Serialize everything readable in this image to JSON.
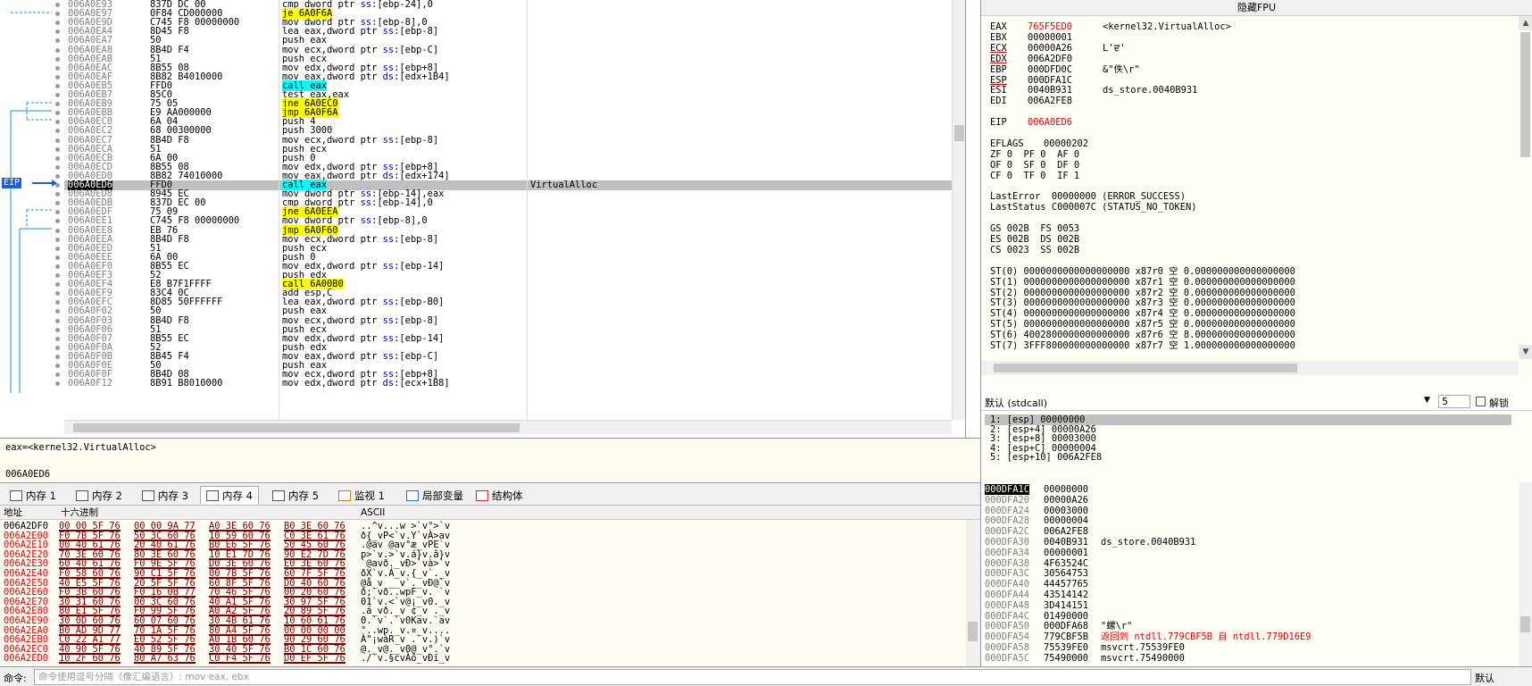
{
  "disasm_rows": [
    {
      "addr": "006A0E93",
      "bytes": "837D DC 00",
      "mn": "cmp dword ptr ss:[ebp-24],0",
      "hl": ""
    },
    {
      "addr": "006A0E97",
      "bytes": "0F84 CD000000",
      "mn": "je 6A0F6A",
      "hl": "y"
    },
    {
      "addr": "006A0E9D",
      "bytes": "C745 F8 00000000",
      "mn": "mov dword ptr ss:[ebp-8],0",
      "hl": ""
    },
    {
      "addr": "006A0EA4",
      "bytes": "8D45 F8",
      "mn": "lea eax,dword ptr ss:[ebp-8]",
      "hl": ""
    },
    {
      "addr": "006A0EA7",
      "bytes": "50",
      "mn": "push eax",
      "hl": ""
    },
    {
      "addr": "006A0EA8",
      "bytes": "8B4D F4",
      "mn": "mov ecx,dword ptr ss:[ebp-C]",
      "hl": ""
    },
    {
      "addr": "006A0EAB",
      "bytes": "51",
      "mn": "push ecx",
      "hl": ""
    },
    {
      "addr": "006A0EAC",
      "bytes": "8B55 08",
      "mn": "mov edx,dword ptr ss:[ebp+8]",
      "hl": ""
    },
    {
      "addr": "006A0EAF",
      "bytes": "8B82 B4010000",
      "mn": "mov eax,dword ptr ds:[edx+1B4]",
      "hl": ""
    },
    {
      "addr": "006A0EB5",
      "bytes": "FFD0",
      "mn": "call eax",
      "hl": "c"
    },
    {
      "addr": "006A0EB7",
      "bytes": "85C0",
      "mn": "test eax,eax",
      "hl": ""
    },
    {
      "addr": "006A0EB9",
      "bytes": "75 05",
      "mn": "jne 6A0EC0",
      "hl": "y"
    },
    {
      "addr": "006A0EBB",
      "bytes": "E9 AA000000",
      "mn": "jmp 6A0F6A",
      "hl": "y"
    },
    {
      "addr": "006A0EC0",
      "bytes": "6A 04",
      "mn": "push 4",
      "hl": ""
    },
    {
      "addr": "006A0EC2",
      "bytes": "68 00300000",
      "mn": "push 3000",
      "hl": ""
    },
    {
      "addr": "006A0EC7",
      "bytes": "8B4D F8",
      "mn": "mov ecx,dword ptr ss:[ebp-8]",
      "hl": ""
    },
    {
      "addr": "006A0ECA",
      "bytes": "51",
      "mn": "push ecx",
      "hl": ""
    },
    {
      "addr": "006A0ECB",
      "bytes": "6A 00",
      "mn": "push 0",
      "hl": ""
    },
    {
      "addr": "006A0ECD",
      "bytes": "8B55 08",
      "mn": "mov edx,dword ptr ss:[ebp+8]",
      "hl": ""
    },
    {
      "addr": "006A0ED0",
      "bytes": "8B82 74010000",
      "mn": "mov eax,dword ptr ds:[edx+174]",
      "hl": ""
    },
    {
      "addr": "006A0ED6",
      "bytes": "FFD0",
      "mn": "call eax",
      "hl": "c",
      "comment": "VirtualAlloc",
      "sel": true
    },
    {
      "addr": "006A0ED8",
      "bytes": "8945 EC",
      "mn": "mov dword ptr ss:[ebp-14],eax",
      "hl": ""
    },
    {
      "addr": "006A0EDB",
      "bytes": "837D EC 00",
      "mn": "cmp dword ptr ss:[ebp-14],0",
      "hl": ""
    },
    {
      "addr": "006A0EDF",
      "bytes": "75 09",
      "mn": "jne 6A0EEA",
      "hl": "y"
    },
    {
      "addr": "006A0EE1",
      "bytes": "C745 F8 00000000",
      "mn": "mov dword ptr ss:[ebp-8],0",
      "hl": ""
    },
    {
      "addr": "006A0EE8",
      "bytes": "EB 76",
      "mn": "jmp 6A0F60",
      "hl": "y"
    },
    {
      "addr": "006A0EEA",
      "bytes": "8B4D F8",
      "mn": "mov ecx,dword ptr ss:[ebp-8]",
      "hl": ""
    },
    {
      "addr": "006A0EED",
      "bytes": "51",
      "mn": "push ecx",
      "hl": ""
    },
    {
      "addr": "006A0EEE",
      "bytes": "6A 00",
      "mn": "push 0",
      "hl": ""
    },
    {
      "addr": "006A0EF0",
      "bytes": "8B55 EC",
      "mn": "mov edx,dword ptr ss:[ebp-14]",
      "hl": ""
    },
    {
      "addr": "006A0EF3",
      "bytes": "52",
      "mn": "push edx",
      "hl": ""
    },
    {
      "addr": "006A0EF4",
      "bytes": "E8 B7F1FFFF",
      "mn": "call 6A00B0",
      "hl": "y"
    },
    {
      "addr": "006A0EF9",
      "bytes": "83C4 0C",
      "mn": "add esp,C",
      "hl": ""
    },
    {
      "addr": "006A0EFC",
      "bytes": "8D85 50FFFFFF",
      "mn": "lea eax,dword ptr ss:[ebp-B0]",
      "hl": ""
    },
    {
      "addr": "006A0F02",
      "bytes": "50",
      "mn": "push eax",
      "hl": ""
    },
    {
      "addr": "006A0F03",
      "bytes": "8B4D F8",
      "mn": "mov ecx,dword ptr ss:[ebp-8]",
      "hl": ""
    },
    {
      "addr": "006A0F06",
      "bytes": "51",
      "mn": "push ecx",
      "hl": ""
    },
    {
      "addr": "006A0F07",
      "bytes": "8B55 EC",
      "mn": "mov edx,dword ptr ss:[ebp-14]",
      "hl": ""
    },
    {
      "addr": "006A0F0A",
      "bytes": "52",
      "mn": "push edx",
      "hl": ""
    },
    {
      "addr": "006A0F0B",
      "bytes": "8B45 F4",
      "mn": "mov eax,dword ptr ss:[ebp-C]",
      "hl": ""
    },
    {
      "addr": "006A0F0E",
      "bytes": "50",
      "mn": "push eax",
      "hl": ""
    },
    {
      "addr": "006A0F0F",
      "bytes": "8B4D 08",
      "mn": "mov ecx,dword ptr ss:[ebp+8]",
      "hl": ""
    },
    {
      "addr": "006A0F12",
      "bytes": "8B91 B8010000",
      "mn": "mov edx,dword ptr ds:[ecx+1B8]",
      "hl": ""
    }
  ],
  "eip_label": "EIP",
  "info": {
    "line1": "eax=<kernel32.VirtualAlloc>",
    "line2": "006A0ED6"
  },
  "regs": {
    "title": "隐藏FPU",
    "lines": [
      {
        "n": "EAX",
        "v": "765F5ED0",
        "c": "<kernel32.VirtualAlloc>",
        "red": true
      },
      {
        "n": "EBX",
        "v": "00000001",
        "c": ""
      },
      {
        "n": "ECX",
        "v": "00000A26",
        "c": "L'ਦ'",
        "ul": true
      },
      {
        "n": "EDX",
        "v": "006A2DF0",
        "c": "",
        "ul": true
      },
      {
        "n": "EBP",
        "v": "000DFD0C",
        "c": "&\"佚\\r\""
      },
      {
        "n": "ESP",
        "v": "000DFA1C",
        "c": "",
        "ul": true
      },
      {
        "n": "ESI",
        "v": "0040B931",
        "c": "ds_store.0040B931"
      },
      {
        "n": "EDI",
        "v": "006A2FE8",
        "c": ""
      },
      {
        "n": "",
        "v": "",
        "c": ""
      },
      {
        "n": "EIP",
        "v": "006A0ED6",
        "c": "",
        "red": true
      },
      {
        "n": "",
        "v": "",
        "c": ""
      },
      {
        "n": "EFLAGS",
        "v": "00000202",
        "c": ""
      },
      {
        "n": "ZF 0  PF 0  AF 0",
        "v": "",
        "c": ""
      },
      {
        "n": "OF 0  SF 0  DF 0",
        "v": "",
        "c": ""
      },
      {
        "n": "CF 0  TF 0  IF 1",
        "v": "",
        "c": ""
      },
      {
        "n": "",
        "v": "",
        "c": ""
      },
      {
        "n": "LastError  00000000 (ERROR_SUCCESS)",
        "v": "",
        "c": ""
      },
      {
        "n": "LastStatus C000007C (STATUS_NO_TOKEN)",
        "v": "",
        "c": ""
      },
      {
        "n": "",
        "v": "",
        "c": ""
      },
      {
        "n": "GS 002B  FS 0053",
        "v": "",
        "c": ""
      },
      {
        "n": "ES 002B  DS 002B",
        "v": "",
        "c": ""
      },
      {
        "n": "CS 0023  SS 002B",
        "v": "",
        "c": ""
      },
      {
        "n": "",
        "v": "",
        "c": ""
      },
      {
        "n": "ST(0) 0000000000000000000 x87r0 空 0.000000000000000000",
        "v": "",
        "c": ""
      },
      {
        "n": "ST(1) 0000000000000000000 x87r1 空 0.000000000000000000",
        "v": "",
        "c": ""
      },
      {
        "n": "ST(2) 0000000000000000000 x87r2 空 0.000000000000000000",
        "v": "",
        "c": ""
      },
      {
        "n": "ST(3) 0000000000000000000 x87r3 空 0.000000000000000000",
        "v": "",
        "c": ""
      },
      {
        "n": "ST(4) 0000000000000000000 x87r4 空 0.000000000000000000",
        "v": "",
        "c": ""
      },
      {
        "n": "ST(5) 0000000000000000000 x87r5 空 0.000000000000000000",
        "v": "",
        "c": ""
      },
      {
        "n": "ST(6) 4002800000000000000 x87r6 空 8.000000000000000000",
        "v": "",
        "c": ""
      },
      {
        "n": "ST(7) 3FFF800000000000000 x87r7 空 1.000000000000000000",
        "v": "",
        "c": ""
      }
    ]
  },
  "stackargs": {
    "convention": "默认 (stdcall)",
    "count": "5",
    "unlock": "解锁",
    "lines": [
      "1: [esp] 00000000",
      "2: [esp+4] 00000A26",
      "3: [esp+8] 00003000",
      "4: [esp+C] 00000004",
      "5: [esp+10] 006A2FE8"
    ]
  },
  "tabs": [
    {
      "label": "内存 1"
    },
    {
      "label": "内存 2"
    },
    {
      "label": "内存 3"
    },
    {
      "label": "内存 4",
      "active": true
    },
    {
      "label": "内存 5"
    },
    {
      "label": "监视 1"
    },
    {
      "label": "局部变量"
    },
    {
      "label": "结构体"
    }
  ],
  "dump": {
    "hdr_addr": "地址",
    "hdr_hex": "十六进制",
    "hdr_ascii": "ASCII",
    "rows": [
      {
        "a": "006A2DF0",
        "h": [
          "00 00 5F 76",
          "00 00 9A 77",
          "A0 3E 60 76",
          "B0 3E 60 76"
        ],
        "s": "..^v...w >`v°>`v"
      },
      {
        "a": "006A2E00",
        "h": [
          "F0 7B 5F 76",
          "50 3C 60 76",
          "10 59 60 76",
          "C0 3E 61 76"
        ],
        "s": "ð{_vP<`v.Y`vÀ>av"
      },
      {
        "a": "006A2E10",
        "h": [
          "00 40 61 76",
          "20 40 61 76",
          "B0 E6 5F 76",
          "50 45 60 76"
        ],
        "s": ".@av @av°æ_vPE`v"
      },
      {
        "a": "006A2E20",
        "h": [
          "70 3E 60 76",
          "80 3E 60 76",
          "10 E1 7D 76",
          "90 E2 7D 76"
        ],
        "s": "p>`v.>`v.á}v.â}v"
      },
      {
        "a": "006A2E30",
        "h": [
          "60 40 61 76",
          "F0 9E 5F 76",
          "D0 3E 60 76",
          "E0 3E 60 76"
        ],
        "s": "`@avð._vÐ>`và>`v"
      },
      {
        "a": "006A2E40",
        "h": [
          "F0 58 60 76",
          "90 C1 5F 76",
          "00 7B 5F 76",
          "60 7F 5F 76"
        ],
        "s": "ðX`v.Á_v.{_v`._v"
      },
      {
        "a": "006A2E50",
        "h": [
          "40 E5 5F 76",
          "20 5F 5F 76",
          "60 8F 5F 76",
          "D0 40 60 76"
        ],
        "s": "@å_v __v`._vÐ@`v"
      },
      {
        "a": "006A2E60",
        "h": [
          "F0 3B 60 76",
          "F0 16 0B 77",
          "70 46 5F 76",
          "00 20 60 76"
        ],
        "s": "ð;`vð..wpF_v. `v"
      },
      {
        "a": "006A2E70",
        "h": [
          "30 31 60 76",
          "00 3C 60 76",
          "40 A1 5F 76",
          "30 97 5F 76"
        ],
        "s": "01`v.<`v@¡_v0._v"
      },
      {
        "a": "006A2E80",
        "h": [
          "80 E1 5F 76",
          "F0 99 5F 76",
          "A0 A2 5F 76",
          "20 89 5F 76"
        ],
        "s": ".á_vð._v ¢_v ._v"
      },
      {
        "a": "006A2E90",
        "h": [
          "30 0D 60 76",
          "60 07 60 76",
          "30 4B 61 76",
          "10 60 61 76"
        ],
        "s": "0.`v`.`v0Kav.`av"
      },
      {
        "a": "006A2EA0",
        "h": [
          "B0 AD 9D 77",
          "70 1A 5F 76",
          "80 A4 5F 76",
          "00 00 00 00"
        ],
        "s": "°..wp._v.¤_v...."
      },
      {
        "a": "006A2EB0",
        "h": [
          "C0 22 A1 77",
          "E0 52 5F 76",
          "A0 1B 60 76",
          "90 29 60 76"
        ],
        "s": "À\"¡wàR_v .`v.)`v"
      },
      {
        "a": "006A2EC0",
        "h": [
          "40 90 5F 76",
          "40 89 5F 76",
          "30 40 5F 76",
          "B0 1C 60 76"
        ],
        "s": "@._v@._v0@_v°.`v"
      },
      {
        "a": "006A2ED0",
        "h": [
          "10 2F 60 76",
          "80 A7 63 76",
          "C0 F4 5F 76",
          "D0 EF 5F 76"
        ],
        "s": "./`v.§cvÀô_vÐï_v"
      }
    ]
  },
  "stack": {
    "rows": [
      {
        "a": "000DFA1C",
        "v": "00000000",
        "c": "",
        "top": true
      },
      {
        "a": "000DFA20",
        "v": "00000A26",
        "c": ""
      },
      {
        "a": "000DFA24",
        "v": "00003000",
        "c": ""
      },
      {
        "a": "000DFA28",
        "v": "00000004",
        "c": ""
      },
      {
        "a": "000DFA2C",
        "v": "006A2FE8",
        "c": ""
      },
      {
        "a": "000DFA30",
        "v": "0040B931",
        "c": "ds_store.0040B931"
      },
      {
        "a": "000DFA34",
        "v": "00000001",
        "c": ""
      },
      {
        "a": "000DFA38",
        "v": "4F63524C",
        "c": ""
      },
      {
        "a": "000DFA3C",
        "v": "30564753",
        "c": ""
      },
      {
        "a": "000DFA40",
        "v": "44457765",
        "c": ""
      },
      {
        "a": "000DFA44",
        "v": "43514142",
        "c": ""
      },
      {
        "a": "000DFA48",
        "v": "3D414151",
        "c": ""
      },
      {
        "a": "000DFA4C",
        "v": "01490000",
        "c": ""
      },
      {
        "a": "000DFA50",
        "v": "000DFA68",
        "c": "\"螺\\r\""
      },
      {
        "a": "000DFA54",
        "v": "779CBF5B",
        "c": "返回到 ntdll.779CBF5B 自 ntdll.779D16E9",
        "red": true
      },
      {
        "a": "000DFA58",
        "v": "75539FE0",
        "c": "msvcrt.75539FE0"
      },
      {
        "a": "000DFA5C",
        "v": "75490000",
        "c": "msvcrt.75490000"
      }
    ]
  },
  "cmd": {
    "label": "命令:",
    "placeholder": "命令使用逗号分隔（像汇编语言）: mov eax, ebx",
    "mode": "默认"
  }
}
